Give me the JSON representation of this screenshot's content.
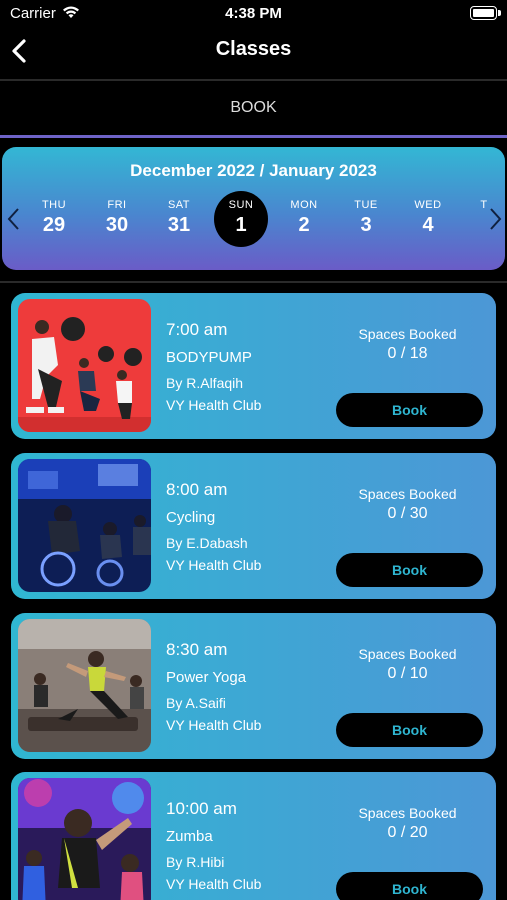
{
  "status_bar": {
    "carrier": "Carrier",
    "time": "4:38 PM"
  },
  "nav": {
    "title": "Classes"
  },
  "tab": {
    "label": "BOOK"
  },
  "calendar": {
    "month_label": "December 2022 / January 2023",
    "days": [
      {
        "name": "THU",
        "num": "29"
      },
      {
        "name": "FRI",
        "num": "30"
      },
      {
        "name": "SAT",
        "num": "31"
      },
      {
        "name": "SUN",
        "num": "1",
        "selected": true
      },
      {
        "name": "MON",
        "num": "2"
      },
      {
        "name": "TUE",
        "num": "3"
      },
      {
        "name": "WED",
        "num": "4"
      },
      {
        "name": "T",
        "num": ""
      }
    ]
  },
  "classes": [
    {
      "time": "7:00 am",
      "name": "BODYPUMP",
      "by": "By R.Alfaqih",
      "club": "VY Health Club",
      "spaces_label": "Spaces Booked",
      "spaces": "0 / 18",
      "button": "Book",
      "image": "bodypump-photo"
    },
    {
      "time": "8:00 am",
      "name": "Cycling",
      "by": "By E.Dabash",
      "club": "VY Health Club",
      "spaces_label": "Spaces Booked",
      "spaces": "0 / 30",
      "button": "Book",
      "image": "cycling-photo"
    },
    {
      "time": "8:30 am",
      "name": "Power Yoga",
      "by": "By A.Saifi",
      "club": "VY Health Club",
      "spaces_label": "Spaces Booked",
      "spaces": "0 / 10",
      "button": "Book",
      "image": "yoga-photo"
    },
    {
      "time": "10:00 am",
      "name": "Zumba",
      "by": "By R.Hibi",
      "club": "VY Health Club",
      "spaces_label": "Spaces Booked",
      "spaces": "0 / 20",
      "button": "Book",
      "image": "zumba-photo"
    }
  ],
  "colors": {
    "accent": "#2fb5d0",
    "tab_underline": "#6e63c7",
    "card_start": "#30b7d2",
    "card_end": "#4c97d6"
  }
}
